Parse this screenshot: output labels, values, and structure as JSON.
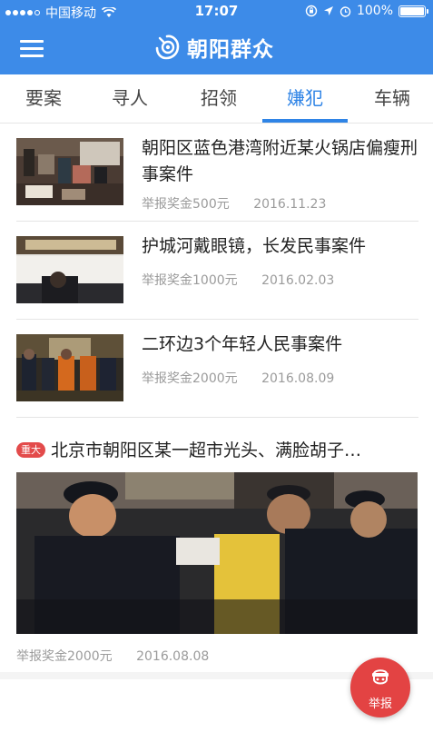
{
  "status_bar": {
    "carrier": "中国移动",
    "time": "17:07",
    "battery": "100%"
  },
  "nav": {
    "title": "朝阳群众"
  },
  "tabs": [
    {
      "label": "要案"
    },
    {
      "label": "寻人"
    },
    {
      "label": "招领"
    },
    {
      "label": "嫌犯"
    },
    {
      "label": "车辆"
    }
  ],
  "active_tab": "嫌犯",
  "items": [
    {
      "title": "朝阳区蓝色港湾附近某火锅店偏瘦刑事案件",
      "reward": "举报奖金500元",
      "date": "2016.11.23"
    },
    {
      "title": "护城河戴眼镜，长发民事案件",
      "reward": "举报奖金1000元",
      "date": "2016.02.03"
    },
    {
      "title": "二环边3个年轻人民事案件",
      "reward": "举报奖金2000元",
      "date": "2016.08.09"
    }
  ],
  "featured": {
    "badge": "重大",
    "title": "北京市朝阳区某一超市光头、满脸胡子…",
    "reward": "举报奖金2000元",
    "date": "2016.08.08"
  },
  "report_button": {
    "label": "举报"
  },
  "colors": {
    "primary": "#3d8be8",
    "active_tab": "#2f84e6",
    "badge": "#e34b4b",
    "fab": "#e34343"
  }
}
